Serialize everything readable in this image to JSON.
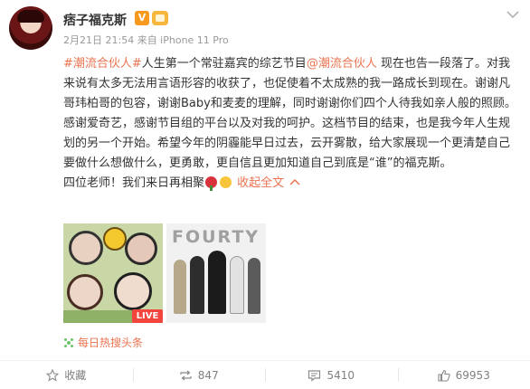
{
  "user": {
    "name": "痞子福克斯",
    "verified": "V",
    "meta": "2月21日 21:54 来自 iPhone 11 Pro"
  },
  "post": {
    "topic_1": "#潮流合伙人#",
    "text_1": "人生第一个常驻嘉宾的综艺节目",
    "mention": "@潮流合伙人",
    "text_2": " 现在也告一段落了。对我来说有太多无法用言语形容的收获了，也促使着不太成熟的我一路成长到现在。谢谢凡哥玮柏哥的包容，谢谢Baby和麦麦的理解，同时谢谢你们四个人待我如亲人般的照顾。感谢爱奇艺，感谢节目组的平台以及对我的呵护。这档节目的结束，也是我今年人生规划的另一个开始。希望今年的阴霾能早日过去，云开雾散，给大家展现一个更清楚自己要做什么想做什么，更勇敢，更自信且更加知道自己到底是“谁”的福克斯。",
    "text_3": "四位老师！我们来日再相聚",
    "collapse_label": "收起全文"
  },
  "media": {
    "live_badge": "LIVE",
    "poster_title": "FOURTY"
  },
  "hot_label": "每日热搜头条",
  "actions": {
    "favorite": "收藏",
    "repost": "847",
    "comment": "5410",
    "like": "69953"
  },
  "colors": {
    "accent": "#eb7350",
    "verified_badge": "#f79a1e",
    "live_badge": "#f2453d"
  },
  "icons": [
    "chevron-down-icon",
    "star-icon",
    "repost-icon",
    "comment-icon",
    "like-icon",
    "hot-search-icon"
  ]
}
